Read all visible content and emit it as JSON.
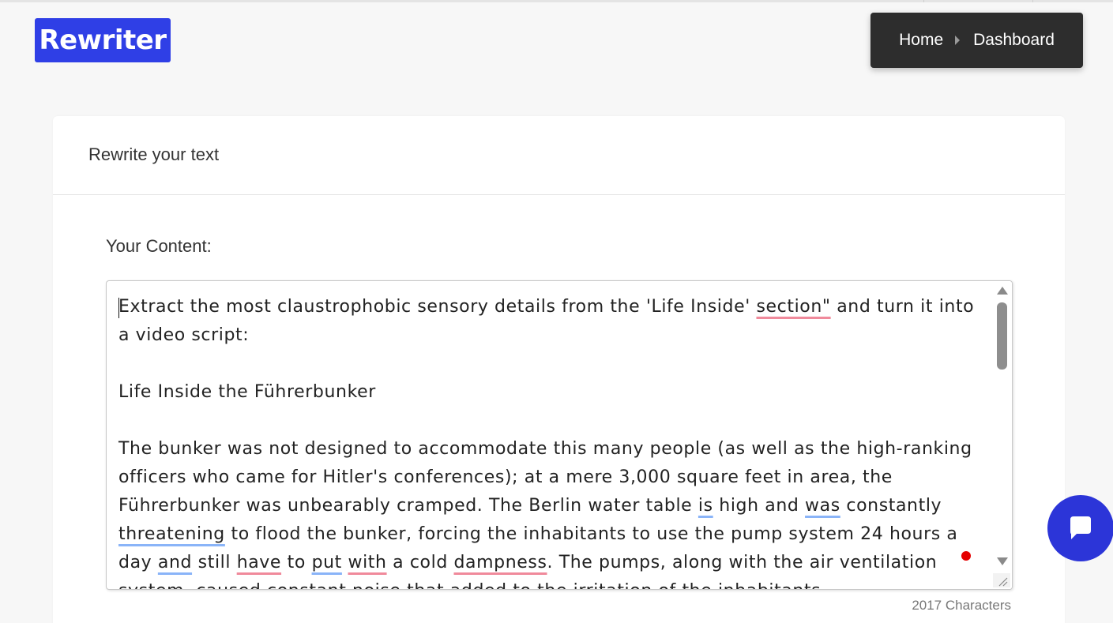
{
  "brand": {
    "logo_text": "Rewriter",
    "color": "#2f3fe6"
  },
  "nav": {
    "items": [
      "Home",
      "Dashboard"
    ]
  },
  "card": {
    "header": "Rewrite your text",
    "content_label": "Your Content:",
    "editor": {
      "paragraphs": [
        [
          {
            "t": "Extract the most claustrophobic sensory details from the 'Life Inside' "
          },
          {
            "t": "section\"",
            "u": "red"
          },
          {
            "t": " and turn it into a video script:"
          }
        ],
        [
          {
            "t": "Life Inside the Führerbunker"
          }
        ],
        [
          {
            "t": "The bunker was not designed to accommodate this many people (as well as the high-ranking officers who came for Hitler's conferences); at a mere 3,000 square feet in area, the Führerbunker was unbearably cramped. The Berlin water table "
          },
          {
            "t": "is",
            "u": "blue"
          },
          {
            "t": " high and "
          },
          {
            "t": "was",
            "u": "blue"
          },
          {
            "t": " constantly "
          },
          {
            "t": "threatening",
            "u": "blue"
          },
          {
            "t": " to flood the bunker, forcing the inhabitants to use the pump system 24 hours a day "
          },
          {
            "t": "and",
            "u": "blue"
          },
          {
            "t": " still "
          },
          {
            "t": "have",
            "u": "red"
          },
          {
            "t": " to "
          },
          {
            "t": "put",
            "u": "blue"
          },
          {
            "t": " "
          },
          {
            "t": "with",
            "u": "red"
          },
          {
            "t": " a cold "
          },
          {
            "t": "dampness",
            "u": "red"
          },
          {
            "t": ". The pumps, along with the air ventilation system, caused constant noise that added to the irritation of the inhabitants."
          }
        ]
      ]
    },
    "char_count": "2017 Characters"
  },
  "colors": {
    "accent": "#2f3fe6",
    "nav_bg": "#2d2d2d",
    "chat_button": "#2c35d8",
    "spell_error": "#f08a9b",
    "grammar_hint": "#8ab4f8",
    "record_dot": "#e50000"
  },
  "icons": {
    "chat": "chat-bubble-icon",
    "breadcrumb_separator": "caret-right-icon",
    "scroll_up": "triangle-up-icon",
    "scroll_down": "triangle-down-icon",
    "resize": "resize-grip-icon"
  }
}
